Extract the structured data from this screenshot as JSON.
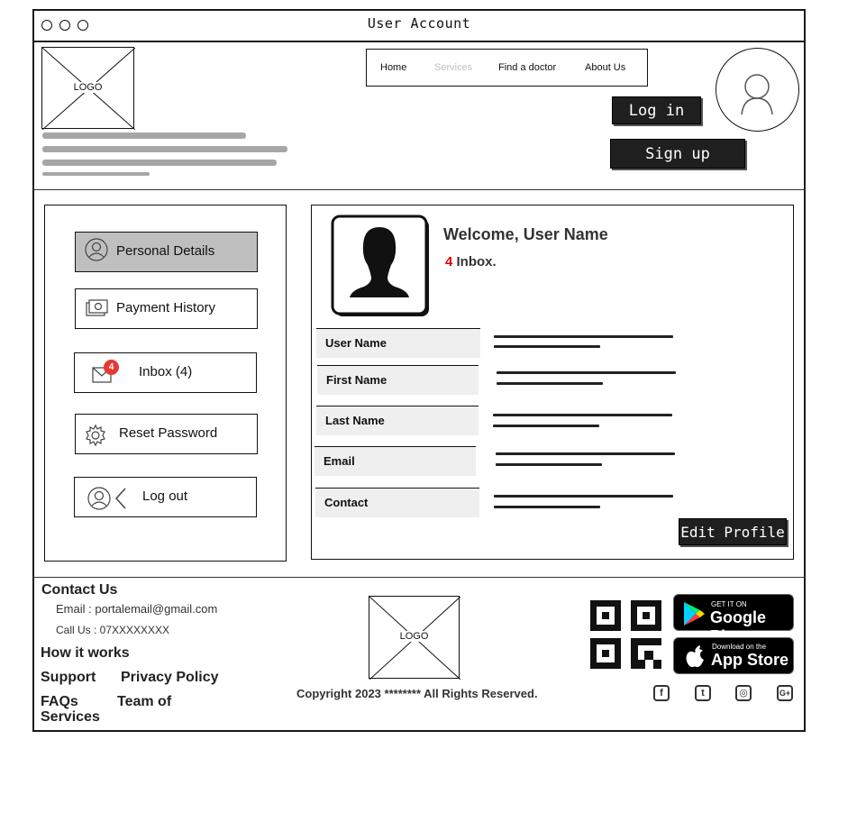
{
  "window": {
    "title": "User Account"
  },
  "header": {
    "logo_label": "LOGO",
    "nav": [
      {
        "label": "Home",
        "state": "normal"
      },
      {
        "label": "Services",
        "state": "disabled"
      },
      {
        "label": "Find a doctor",
        "state": "normal"
      },
      {
        "label": "About Us",
        "state": "normal"
      }
    ],
    "login_label": "Log in",
    "signup_label": "Sign up",
    "avatar_icon": "user-avatar-icon"
  },
  "sidebar": {
    "items": [
      {
        "label": "Personal Details",
        "icon": "user-circle-icon",
        "active": true
      },
      {
        "label": "Payment History",
        "icon": "money-icon",
        "active": false
      },
      {
        "label": "Inbox (4)",
        "icon": "envelope-icon",
        "badge": "4",
        "active": false
      },
      {
        "label": "Reset Password",
        "icon": "gear-icon",
        "active": false
      },
      {
        "label": "Log out",
        "icon": "logout-icon",
        "active": false
      }
    ]
  },
  "profile": {
    "welcome": "Welcome, User Name",
    "inbox_count": "4",
    "inbox_label": "Inbox.",
    "fields": [
      {
        "label": "User Name"
      },
      {
        "label": "First Name"
      },
      {
        "label": "Last Name"
      },
      {
        "label": "Email"
      },
      {
        "label": "Contact"
      }
    ],
    "edit_label": "Edit Profile"
  },
  "footer": {
    "contact_heading": "Contact Us",
    "email": "Email : portalemail@gmail.com",
    "phone": "Call Us : 07XXXXXXXX",
    "links": {
      "how": "How it works",
      "support": "Support",
      "privacy": "Privacy Policy",
      "faqs": "FAQs",
      "team": "Team of",
      "services": "Services"
    },
    "logo_label": "LOGO",
    "copyright": "Copyright 2023 ******** All Rights Reserved.",
    "google_small": "GET IT ON",
    "google_big": "Google Play",
    "apple_small": "Download on the",
    "apple_big": "App Store",
    "social": [
      {
        "icon": "facebook-icon",
        "glyph": "f"
      },
      {
        "icon": "twitter-icon",
        "glyph": "t"
      },
      {
        "icon": "instagram-icon",
        "glyph": "◎"
      },
      {
        "icon": "google-plus-icon",
        "glyph": "G+"
      }
    ]
  },
  "colors": {
    "badge": "#e53935",
    "active_menu": "#bfbfbf",
    "inbox_count": "#e00000"
  }
}
